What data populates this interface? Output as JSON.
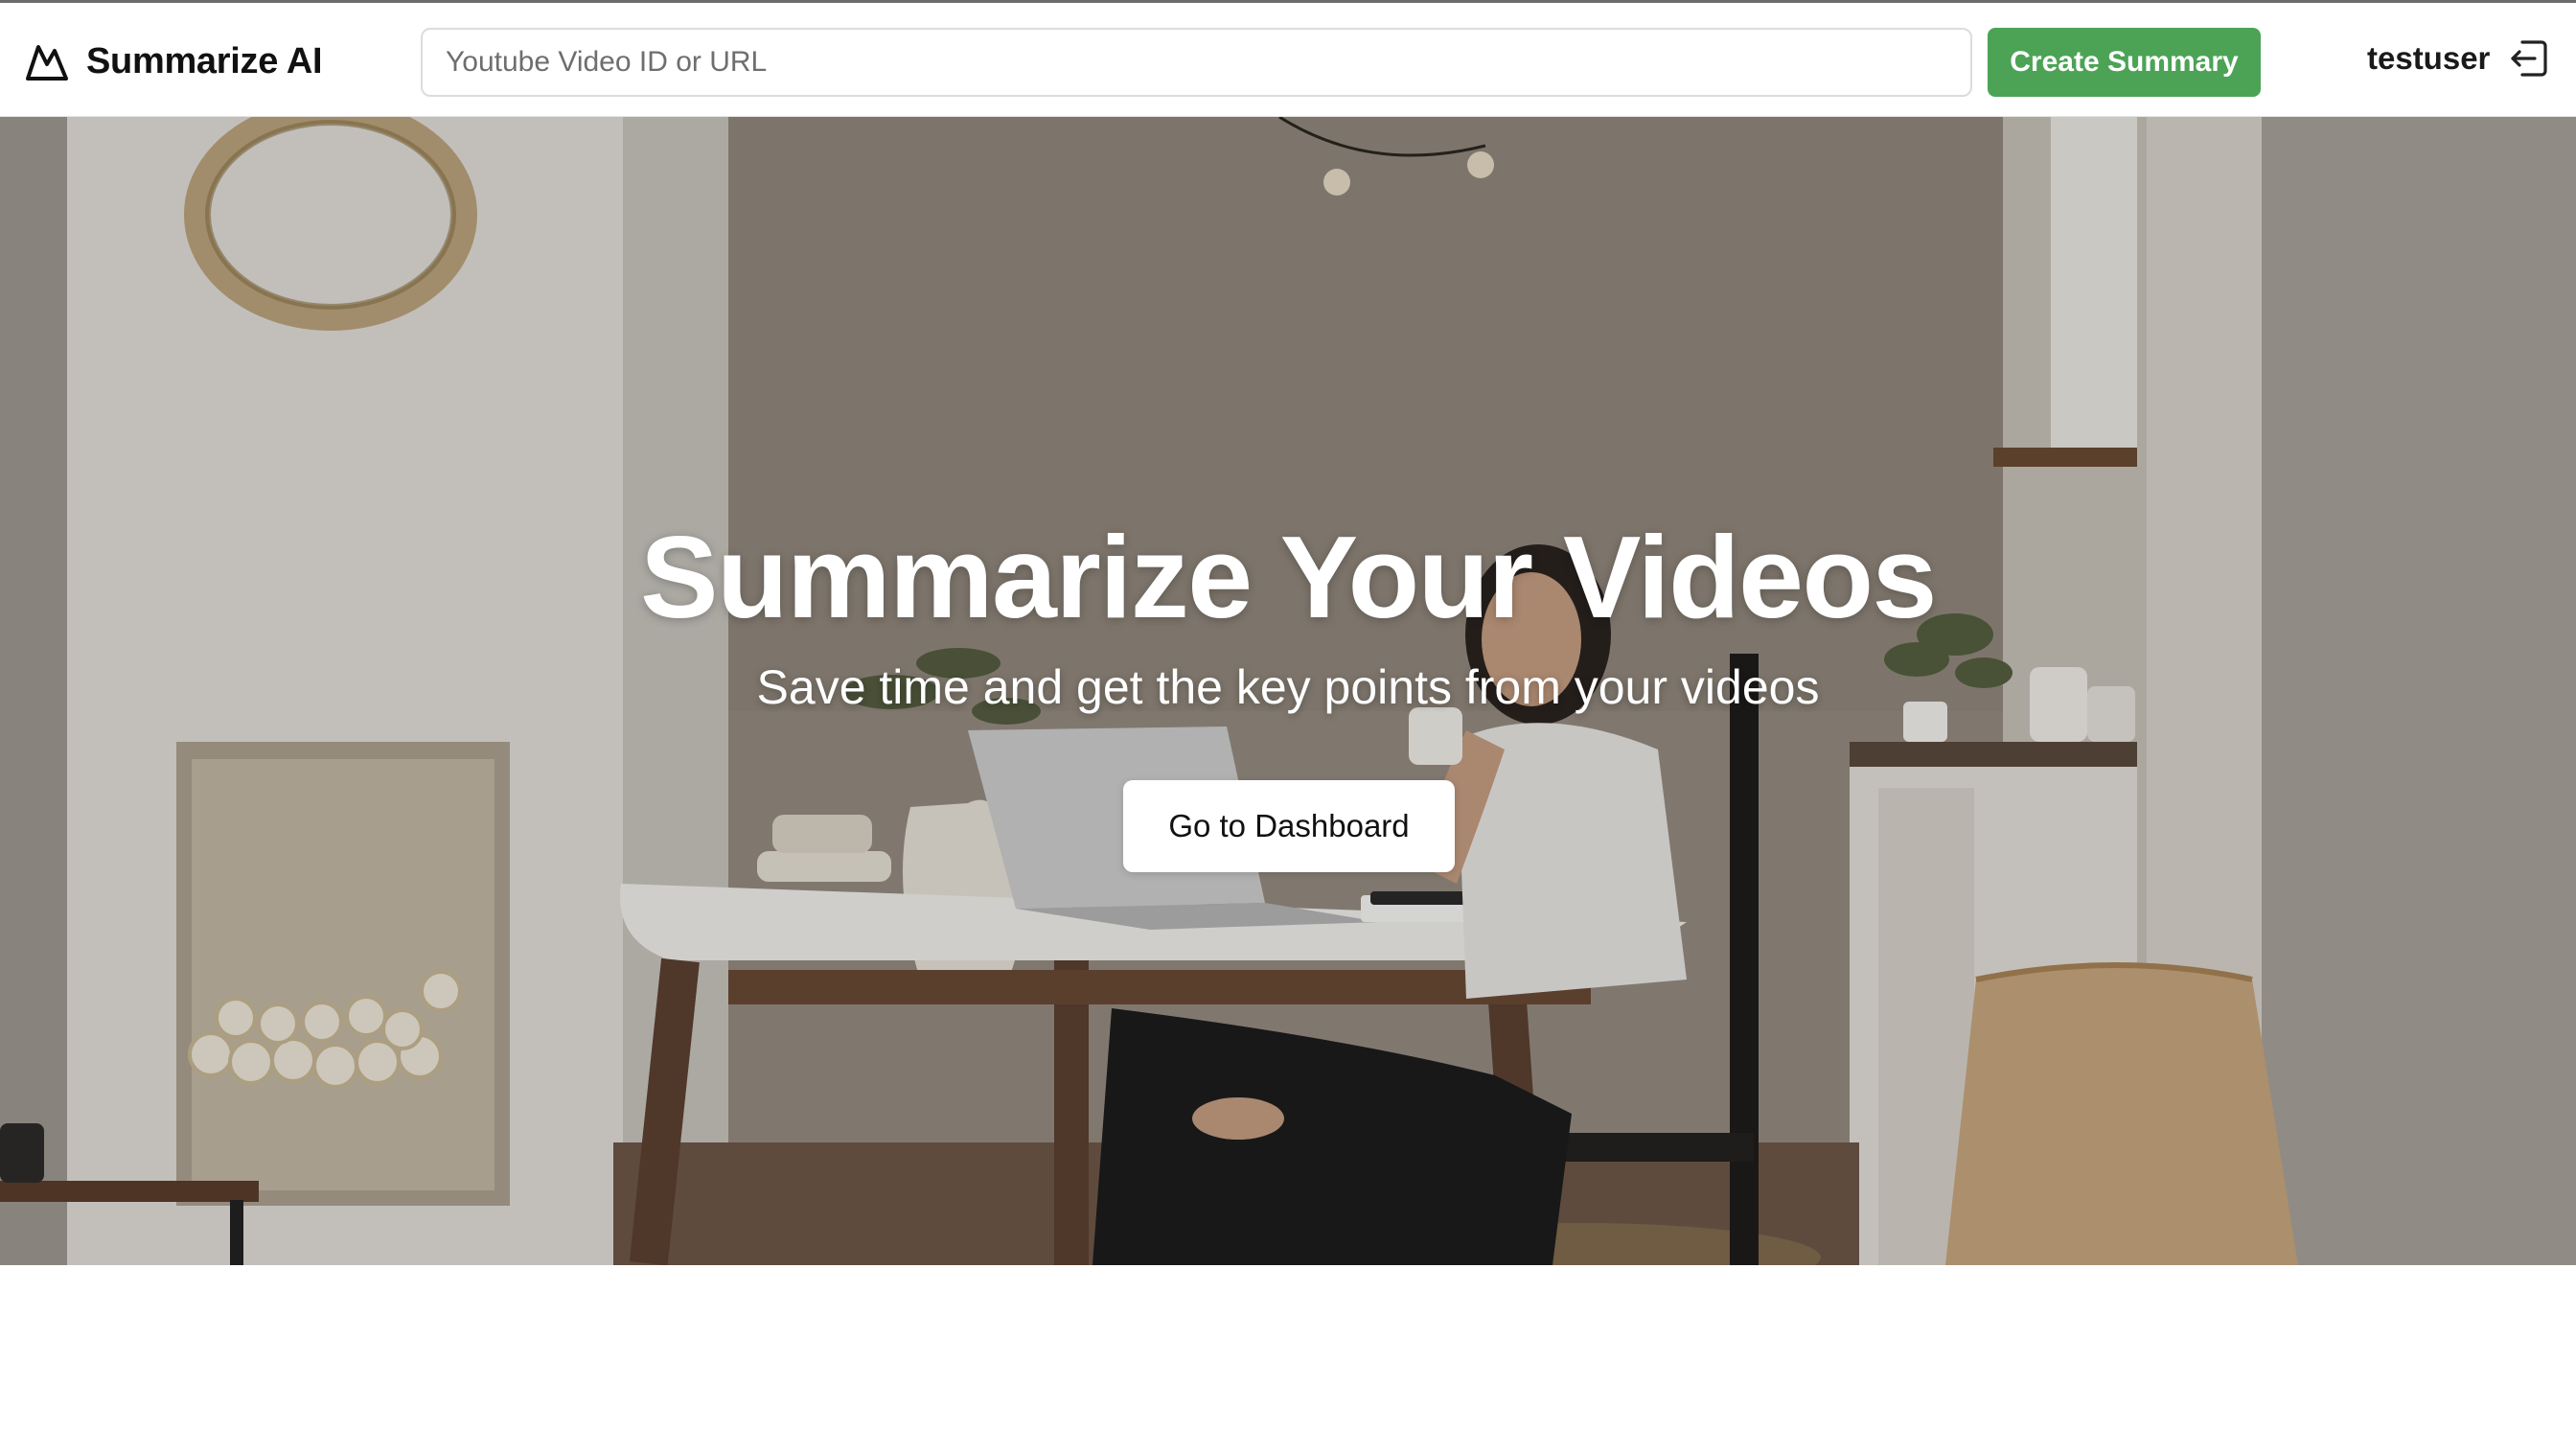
{
  "header": {
    "brand_name": "Summarize AI",
    "brand_icon": "mountain-icon",
    "search": {
      "placeholder": "Youtube Video ID or URL",
      "value": ""
    },
    "create_button_label": "Create Summary",
    "username": "testuser",
    "logout_icon": "logout-icon"
  },
  "hero": {
    "title": "Summarize Your Videos",
    "subtitle": "Save time and get the key points from your videos",
    "cta_label": "Go to Dashboard",
    "background_image": "woman at desk with laptop in a kitchen"
  },
  "colors": {
    "accent": "#4ca356",
    "text": "#111111",
    "background": "#ffffff"
  }
}
